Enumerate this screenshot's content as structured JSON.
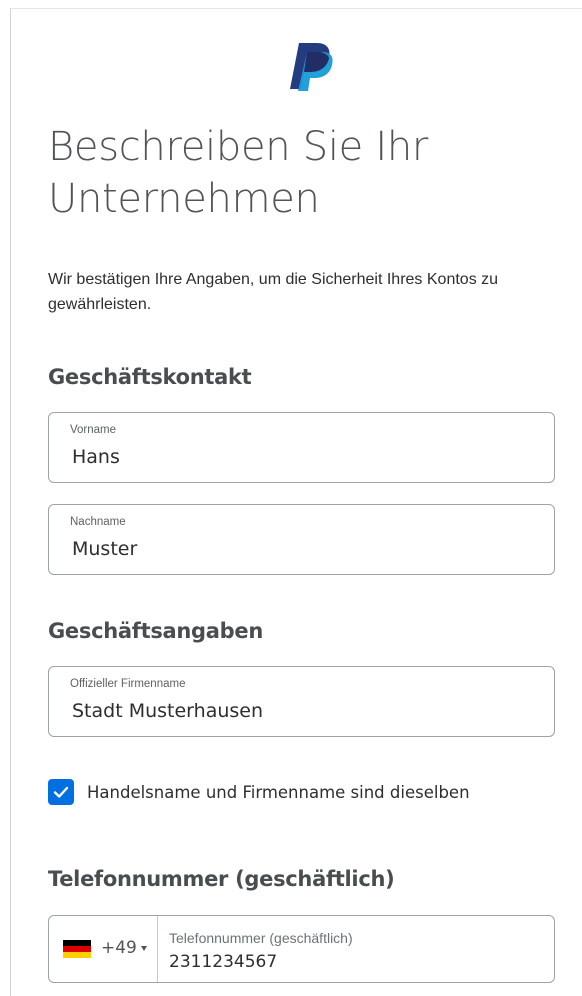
{
  "brand": {
    "logo": "paypal-logo",
    "colors": {
      "dark": "#253b80",
      "light": "#179bd7"
    }
  },
  "page": {
    "title": "Beschreiben Sie Ihr Unternehmen",
    "intro": "Wir bestätigen Ihre Angaben, um die Sicherheit Ihres Kontos zu gewährleisten."
  },
  "contact": {
    "heading": "Geschäftskontakt",
    "first_name": {
      "label": "Vorname",
      "value": "Hans"
    },
    "last_name": {
      "label": "Nachname",
      "value": "Muster"
    }
  },
  "business": {
    "heading": "Geschäftsangaben",
    "company_name": {
      "label": "Offizieller Firmenname",
      "value": "Stadt Musterhausen"
    },
    "same_name_checkbox": {
      "label": "Handelsname und Firmenname sind dieselben",
      "checked": true
    }
  },
  "phone": {
    "heading": "Telefonnummer (geschäftlich)",
    "country_flag": "germany-flag",
    "dial_code": "+49",
    "field": {
      "label": "Telefonnummer (geschäftlich)",
      "value": "2311234567"
    }
  },
  "accent_color": "#0070e0"
}
